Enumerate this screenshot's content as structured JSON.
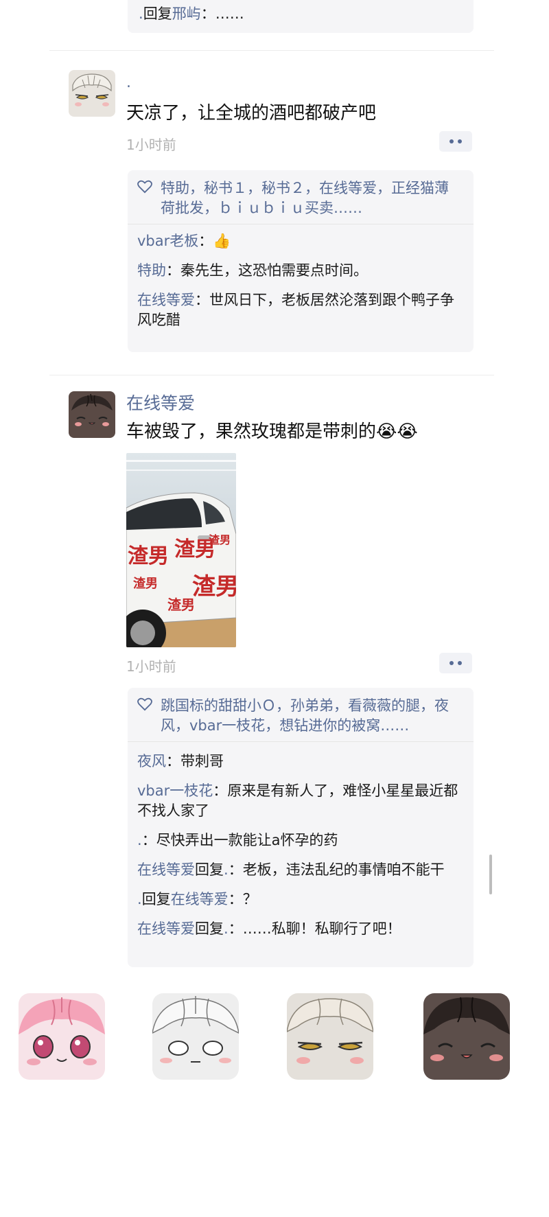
{
  "prev_post": {
    "reply_line": {
      "from": ".",
      "verb": "回复",
      "to": "邢屿",
      "sep": "：",
      "text": "……"
    }
  },
  "posts": [
    {
      "author": ".",
      "text": "天凉了，让全城的酒吧都破产吧",
      "time": "1小时前",
      "likes": "特助，秘书１，秘书２，在线等爱，正经猫薄荷批发，ｂｉｕｂｉｕ买卖……",
      "comments": [
        {
          "name": "vbar老板",
          "sep": "：",
          "text": "👍"
        },
        {
          "name": "特助",
          "sep": "：",
          "text": "秦先生，这恐怕需要点时间。"
        },
        {
          "name": "在线等爱",
          "sep": "：",
          "text": "世风日下，老板居然沦落到跟个鸭子争风吃醋"
        }
      ]
    },
    {
      "author": "在线等爱",
      "text": "车被毁了，果然玫瑰都是带刺的😭😭",
      "time": "1小时前",
      "photo_alt": "渣男",
      "likes": "跳国标的甜甜小Ｏ，孙弟弟，看薇薇的腿，夜风，vbar一枝花，想钻进你的被窝……",
      "comments": [
        {
          "name": "夜风",
          "sep": "：",
          "text": "带刺哥"
        },
        {
          "name": "vbar一枝花",
          "sep": "：",
          "text": "原来是有新人了，难怪小星星最近都不找人家了"
        },
        {
          "name": ".",
          "sep": "：",
          "text": "尽快弄出一款能让a怀孕的药"
        },
        {
          "name": "在线等爱",
          "verb": "回复",
          "to": ".",
          "sep": "：",
          "text": "老板，违法乱纪的事情咱不能干"
        },
        {
          "name": ".",
          "verb": "回复",
          "to": "在线等爱",
          "sep": "：",
          "text": "？"
        },
        {
          "name": "在线等爱",
          "verb": "回复",
          "to": ".",
          "sep": "：",
          "text": "……私聊！私聊行了吧！"
        }
      ]
    }
  ],
  "colors": {
    "link": "#576b95",
    "panel": "#f5f5f7",
    "time": "#b2b2b2"
  },
  "icons": [
    "heart-outline-icon",
    "more-dots-icon"
  ]
}
